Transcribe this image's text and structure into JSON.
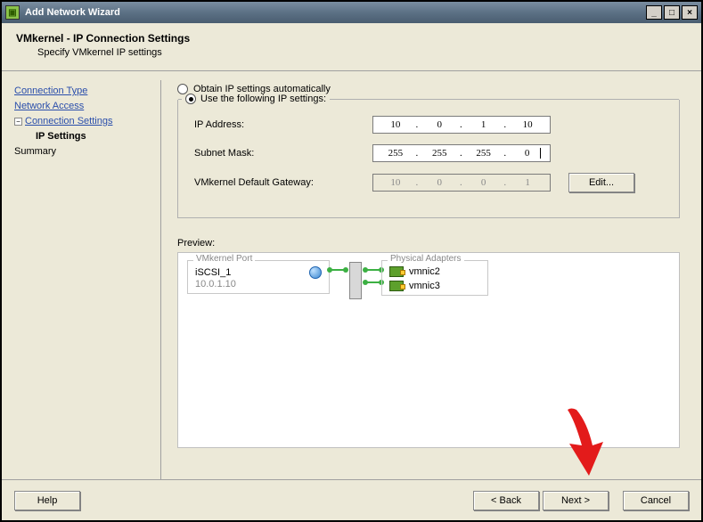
{
  "window": {
    "title": "Add Network Wizard"
  },
  "header": {
    "title": "VMkernel - IP Connection Settings",
    "subtitle": "Specify VMkernel IP settings"
  },
  "sidebar": {
    "items": [
      {
        "label": "Connection Type"
      },
      {
        "label": "Network Access"
      },
      {
        "label": "Connection Settings"
      },
      {
        "label": "IP Settings"
      },
      {
        "label": "Summary"
      }
    ]
  },
  "settings": {
    "radio_auto": "Obtain IP settings automatically",
    "radio_manual": "Use the following IP settings:",
    "ip_label": "IP Address:",
    "subnet_label": "Subnet Mask:",
    "gateway_label": "VMkernel Default Gateway:",
    "ip": [
      "10",
      "0",
      "1",
      "10"
    ],
    "subnet": [
      "255",
      "255",
      "255",
      "0"
    ],
    "gateway": [
      "10",
      "0",
      "0",
      "1"
    ],
    "edit_btn": "Edit..."
  },
  "preview": {
    "label": "Preview:",
    "vmk_group": "VMkernel Port",
    "vmk_name": "iSCSI_1",
    "vmk_ip": "10.0.1.10",
    "phys_group": "Physical Adapters",
    "nic1": "vmnic2",
    "nic2": "vmnic3"
  },
  "buttons": {
    "help": "Help",
    "back": "< Back",
    "next": "Next >",
    "cancel": "Cancel"
  }
}
